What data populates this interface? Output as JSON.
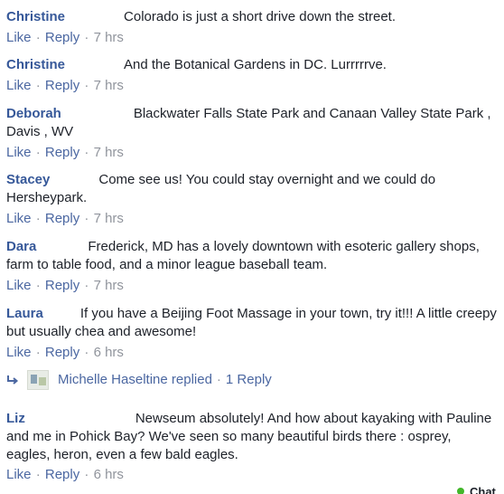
{
  "comments": [
    {
      "name": "Christine",
      "text": "Colorado is just a short drive down the street.",
      "like": "Like",
      "reply": "Reply",
      "time": "7 hrs"
    },
    {
      "name": "Christine",
      "text": "And the Botanical Gardens in DC. Lurrrrrve.",
      "like": "Like",
      "reply": "Reply",
      "time": "7 hrs"
    },
    {
      "name": "Deborah",
      "text": "Blackwater Falls State Park and Canaan Valley State Park , Davis , WV",
      "like": "Like",
      "reply": "Reply",
      "time": "7 hrs"
    },
    {
      "name": "Stacey",
      "text": "Come see us! You could stay overnight and we could do Hersheypark.",
      "like": "Like",
      "reply": "Reply",
      "time": "7 hrs"
    },
    {
      "name": "Dara",
      "text": "Frederick, MD has a lovely downtown with esoteric gallery shops, farm to table food, and a minor league baseball team.",
      "like": "Like",
      "reply": "Reply",
      "time": "7 hrs"
    },
    {
      "name": "Laura",
      "text": "If you have a Beijing Foot Massage in your town, try it!!! A little creepy but usually chea and awesome!",
      "like": "Like",
      "reply": "Reply",
      "time": "6 hrs"
    },
    {
      "name": "Liz",
      "text": "Newseum absolutely! And how about kayaking with Pauline and me in Pohick Bay? We've seen so many beautiful birds there : osprey, eagles, heron, even a few bald eagles.",
      "like": "Like",
      "reply": "Reply",
      "time": "6 hrs"
    }
  ],
  "replies_summary": {
    "text": "Michelle Haseltine replied",
    "count_label": "1 Reply",
    "icon": "reply-arrow-icon"
  },
  "chat": {
    "label": "Chat",
    "status_color": "#42b72a"
  },
  "separator": "·",
  "colors": {
    "name": "#365899",
    "link": "#4b67a1",
    "meta": "#90949c",
    "text": "#1d2129"
  }
}
